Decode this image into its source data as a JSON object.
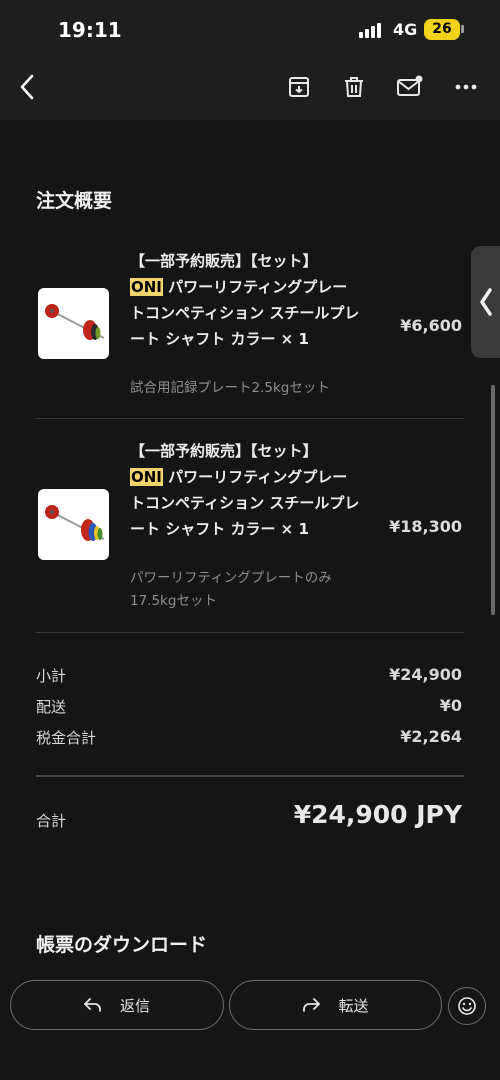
{
  "status_bar": {
    "time": "19:11",
    "network": "4G",
    "battery": "26"
  },
  "toolbar": {
    "back_icon": "chevron-left-icon",
    "actions": [
      "archive-icon",
      "trash-icon",
      "mail-unread-icon",
      "more-icon"
    ]
  },
  "order_summary": {
    "title": "注文概要",
    "items": [
      {
        "title_prefix": "【一部予約販売】【セット】",
        "brand": "ONI",
        "title_rest": " パワーリフティングプレートコンペティション スチールプレート シャフト カラー × 1",
        "variant": "試合用記録プレート2.5kgセット",
        "price": "¥6,600"
      },
      {
        "title_prefix": "【一部予約販売】【セット】",
        "brand": "ONI",
        "title_rest": " パワーリフティングプレートコンペティション スチールプレート シャフト カラー × 1",
        "variant": "パワーリフティングプレートのみ17.5kgセット",
        "price": "¥18,300"
      }
    ],
    "subtotal_label": "小計",
    "subtotal_value": "¥24,900",
    "shipping_label": "配送",
    "shipping_value": "¥0",
    "tax_label": "税金合計",
    "tax_value": "¥2,264",
    "total_label": "合計",
    "total_value": "¥24,900 JPY"
  },
  "download": {
    "title": "帳票のダウンロード"
  },
  "actions": {
    "reply_label": "返信",
    "forward_label": "転送"
  },
  "colors": {
    "background": "#151515",
    "highlight": "#f3d36c",
    "battery": "#f2d21b"
  }
}
